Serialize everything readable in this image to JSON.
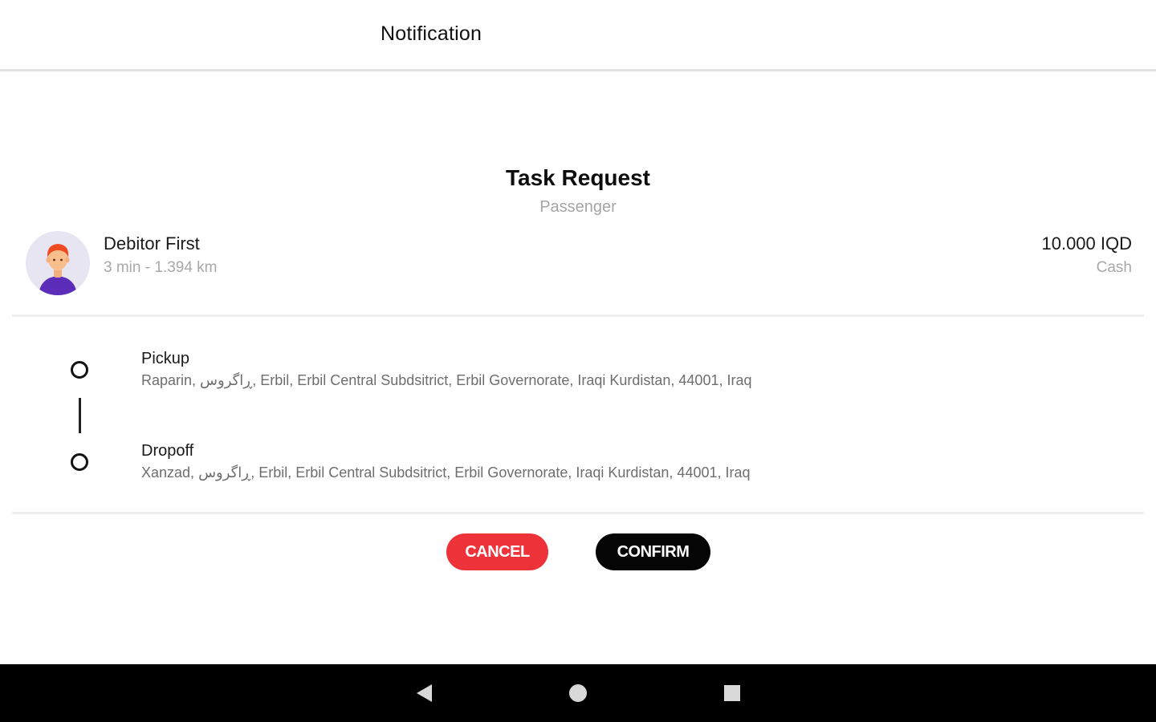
{
  "header": {
    "title": "Notification"
  },
  "task": {
    "title": "Task Request",
    "subtitle": "Passenger"
  },
  "passenger": {
    "name": "Debitor First",
    "eta": "3 min - 1.394 km",
    "fare": "10.000 IQD",
    "payment_method": "Cash",
    "avatar_icon": "user-avatar-icon"
  },
  "route": {
    "pickup": {
      "label": "Pickup",
      "address": "Raparin, ڕاگروس, Erbil, Erbil Central Subdsitrict, Erbil Governorate, Iraqi Kurdistan, 44001, Iraq"
    },
    "dropoff": {
      "label": "Dropoff",
      "address": "Xanzad, ڕاگروس, Erbil, Erbil Central Subdsitrict, Erbil Governorate, Iraqi Kurdistan, 44001, Iraq"
    }
  },
  "actions": {
    "cancel_label": "CANCEL",
    "confirm_label": "CONFIRM"
  },
  "colors": {
    "cancel": "#ee3239",
    "confirm": "#050505",
    "muted_text": "#a8a8a8",
    "navbar": "#000000"
  },
  "system_nav": {
    "back_icon": "back-triangle-icon",
    "home_icon": "home-circle-icon",
    "recents_icon": "recents-square-icon"
  }
}
